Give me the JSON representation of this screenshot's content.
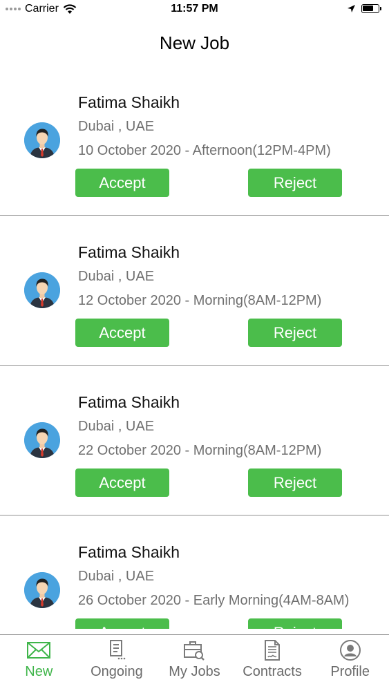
{
  "status_bar": {
    "carrier": "Carrier",
    "time": "11:57 PM",
    "battery_level": 0.7
  },
  "header": {
    "title": "New Job"
  },
  "jobs": [
    {
      "name": "Fatima Shaikh",
      "location": "Dubai , UAE",
      "schedule": "10 October 2020 - Afternoon(12PM-4PM)",
      "accept_label": "Accept",
      "reject_label": "Reject"
    },
    {
      "name": "Fatima Shaikh",
      "location": "Dubai , UAE",
      "schedule": "12 October 2020 - Morning(8AM-12PM)",
      "accept_label": "Accept",
      "reject_label": "Reject"
    },
    {
      "name": "Fatima Shaikh",
      "location": "Dubai , UAE",
      "schedule": "22 October 2020 - Morning(8AM-12PM)",
      "accept_label": "Accept",
      "reject_label": "Reject"
    },
    {
      "name": "Fatima Shaikh",
      "location": "Dubai , UAE",
      "schedule": "26 October 2020 - Early Morning(4AM-8AM)",
      "accept_label": "Accept",
      "reject_label": "Reject"
    }
  ],
  "tabs": [
    {
      "label": "New",
      "icon": "envelope-icon",
      "active": true
    },
    {
      "label": "Ongoing",
      "icon": "list-document-icon",
      "active": false
    },
    {
      "label": "My Jobs",
      "icon": "briefcase-search-icon",
      "active": false
    },
    {
      "label": "Contracts",
      "icon": "contract-document-icon",
      "active": false
    },
    {
      "label": "Profile",
      "icon": "user-circle-icon",
      "active": false
    }
  ],
  "colors": {
    "accent": "#3fb54a",
    "button": "#4bbd4b",
    "secondary_text": "#707070",
    "avatar_bg": "#4aa3df"
  }
}
